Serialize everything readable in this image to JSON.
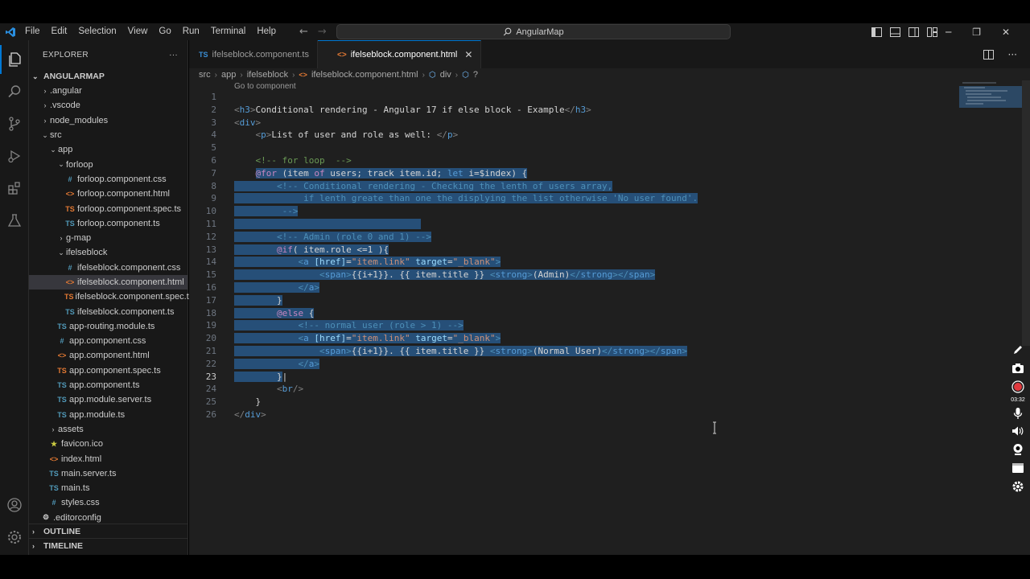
{
  "menu": [
    "File",
    "Edit",
    "Selection",
    "View",
    "Go",
    "Run",
    "Terminal",
    "Help"
  ],
  "search": {
    "label": "AngularMap"
  },
  "explorer": {
    "title": "EXPLORER",
    "more": "···",
    "root": "ANGULARMAP",
    "items": [
      {
        "label": ".angular",
        "indent": 1,
        "kind": "folder",
        "open": false,
        "icon": ""
      },
      {
        "label": ".vscode",
        "indent": 1,
        "kind": "folder",
        "open": false,
        "icon": ""
      },
      {
        "label": "node_modules",
        "indent": 1,
        "kind": "folder",
        "open": false,
        "icon": ""
      },
      {
        "label": "src",
        "indent": 1,
        "kind": "folder",
        "open": true,
        "icon": ""
      },
      {
        "label": "app",
        "indent": 2,
        "kind": "folder",
        "open": true,
        "icon": ""
      },
      {
        "label": "forloop",
        "indent": 3,
        "kind": "folder",
        "open": true,
        "icon": ""
      },
      {
        "label": "forloop.component.css",
        "indent": 4,
        "kind": "css",
        "icon": "#"
      },
      {
        "label": "forloop.component.html",
        "indent": 4,
        "kind": "html",
        "icon": "<>"
      },
      {
        "label": "forloop.component.spec.ts",
        "indent": 4,
        "kind": "spec",
        "icon": "TS"
      },
      {
        "label": "forloop.component.ts",
        "indent": 4,
        "kind": "ts",
        "icon": "TS"
      },
      {
        "label": "g-map",
        "indent": 3,
        "kind": "folder",
        "open": false,
        "icon": ""
      },
      {
        "label": "ifelseblock",
        "indent": 3,
        "kind": "folder",
        "open": true,
        "icon": ""
      },
      {
        "label": "ifelseblock.component.css",
        "indent": 4,
        "kind": "css",
        "icon": "#"
      },
      {
        "label": "ifelseblock.component.html",
        "indent": 4,
        "kind": "html",
        "icon": "<>",
        "selected": true
      },
      {
        "label": "ifelseblock.component.spec.ts",
        "indent": 4,
        "kind": "spec",
        "icon": "TS"
      },
      {
        "label": "ifelseblock.component.ts",
        "indent": 4,
        "kind": "ts",
        "icon": "TS"
      },
      {
        "label": "app-routing.module.ts",
        "indent": 3,
        "kind": "ts",
        "icon": "TS"
      },
      {
        "label": "app.component.css",
        "indent": 3,
        "kind": "css",
        "icon": "#"
      },
      {
        "label": "app.component.html",
        "indent": 3,
        "kind": "html",
        "icon": "<>"
      },
      {
        "label": "app.component.spec.ts",
        "indent": 3,
        "kind": "spec",
        "icon": "TS"
      },
      {
        "label": "app.component.ts",
        "indent": 3,
        "kind": "ts",
        "icon": "TS"
      },
      {
        "label": "app.module.server.ts",
        "indent": 3,
        "kind": "ts",
        "icon": "TS"
      },
      {
        "label": "app.module.ts",
        "indent": 3,
        "kind": "ts",
        "icon": "TS"
      },
      {
        "label": "assets",
        "indent": 2,
        "kind": "folder",
        "open": false,
        "icon": ""
      },
      {
        "label": "favicon.ico",
        "indent": 2,
        "kind": "ico",
        "icon": "★"
      },
      {
        "label": "index.html",
        "indent": 2,
        "kind": "html",
        "icon": "<>"
      },
      {
        "label": "main.server.ts",
        "indent": 2,
        "kind": "ts",
        "icon": "TS"
      },
      {
        "label": "main.ts",
        "indent": 2,
        "kind": "ts",
        "icon": "TS"
      },
      {
        "label": "styles.css",
        "indent": 2,
        "kind": "css",
        "icon": "#"
      },
      {
        "label": ".editorconfig",
        "indent": 1,
        "kind": "config",
        "icon": "⚙"
      }
    ],
    "outline": "OUTLINE",
    "timeline": "TIMELINE"
  },
  "tabs": [
    {
      "badge": "TS",
      "label": "ifelseblock.component.ts",
      "active": false
    },
    {
      "badge": "<>",
      "label": "ifelseblock.component.html",
      "active": true,
      "close": "✕"
    }
  ],
  "breadcrumb": [
    "src",
    "app",
    "ifelseblock",
    "ifelseblock.component.html",
    "div",
    "?"
  ],
  "codelens": "Go to component",
  "code_lines": [
    {
      "n": "1",
      "html": ""
    },
    {
      "n": "2",
      "html": "<span class='p'>&lt;</span><span class='t'>h3</span><span class='p'>&gt;</span><span class='w'>Conditional rendering - Angular 17 if else block - Example</span><span class='p'>&lt;/</span><span class='t'>h3</span><span class='p'>&gt;</span>"
    },
    {
      "n": "3",
      "html": "<span class='p'>&lt;</span><span class='t'>div</span><span class='p'>&gt;</span>"
    },
    {
      "n": "4",
      "html": "    <span class='p'>&lt;</span><span class='t'>p</span><span class='p'>&gt;</span><span class='w'>List of user and role as well: </span><span class='p'>&lt;/</span><span class='t'>p</span><span class='p'>&gt;</span>"
    },
    {
      "n": "5",
      "html": ""
    },
    {
      "n": "6",
      "html": "    <span class='c'>&lt;!-- for loop  --&gt;</span>"
    },
    {
      "n": "7",
      "html": "    <span class='sel'><span class='k'>@for</span><span class='w'> (item </span><span class='k'>of</span><span class='w'> users; track item.id; </span><span class='t'>let</span><span class='w'> i=$index) {</span></span>"
    },
    {
      "n": "8",
      "html": "<span class='sel'>        <span class='c'>&lt;!-- Conditional rendering - Checking the lenth of users array,</span></span>"
    },
    {
      "n": "9",
      "html": "<span class='sel'>             <span class='c'>if lenth greate than one the displying the list otherwise 'No user found'.</span></span>"
    },
    {
      "n": "10",
      "html": "<span class='sel'>         <span class='c'>--&gt;</span></span>"
    },
    {
      "n": "11",
      "html": "<span class='sel'>                                   </span>"
    },
    {
      "n": "12",
      "html": "<span class='sel'>        <span class='c'>&lt;!-- Admin (role 0 and 1) --&gt;</span></span>"
    },
    {
      "n": "13",
      "html": "<span class='sel'>        <span class='k'>@if</span><span class='w'>( item.role &lt;=1 ){</span></span>"
    },
    {
      "n": "14",
      "html": "<span class='sel'>            <span class='p'>&lt;</span><span class='t'>a</span> <span class='a'>[href]</span><span class='w'>=</span><span class='s'>\"item.link\"</span> <span class='a'>target</span><span class='w'>=</span><span class='s'>\"_blank\"</span><span class='p'>&gt;</span></span>"
    },
    {
      "n": "15",
      "html": "<span class='sel'>                <span class='p'>&lt;</span><span class='t'>span</span><span class='p'>&gt;</span><span class='w'>{{i+1}}. {{ item.title }} </span><span class='p'>&lt;</span><span class='t'>strong</span><span class='p'>&gt;</span><span class='w'>(Admin)</span><span class='p'>&lt;/</span><span class='t'>strong</span><span class='p'>&gt;&lt;/</span><span class='t'>span</span><span class='p'>&gt;</span></span>"
    },
    {
      "n": "16",
      "html": "<span class='sel'>            <span class='p'>&lt;/</span><span class='t'>a</span><span class='p'>&gt;</span></span>"
    },
    {
      "n": "17",
      "html": "<span class='sel'>        <span class='w'>}</span></span>"
    },
    {
      "n": "18",
      "html": "<span class='sel'>        <span class='k'>@else</span><span class='w'> {</span></span>"
    },
    {
      "n": "19",
      "html": "<span class='sel'>            <span class='c'>&lt;!-- normal user (role &gt; 1) --&gt;</span></span>"
    },
    {
      "n": "20",
      "html": "<span class='sel'>            <span class='p'>&lt;</span><span class='t'>a</span> <span class='a'>[href]</span><span class='w'>=</span><span class='s'>\"item.link\"</span> <span class='a'>target</span><span class='w'>=</span><span class='s'>\"_blank\"</span><span class='p'>&gt;</span></span>"
    },
    {
      "n": "21",
      "html": "<span class='sel'>                <span class='p'>&lt;</span><span class='t'>span</span><span class='p'>&gt;</span><span class='w'>{{i+1}}. {{ item.title }} </span><span class='p'>&lt;</span><span class='t'>strong</span><span class='p'>&gt;</span><span class='w'>(Normal User)</span><span class='p'>&lt;/</span><span class='t'>strong</span><span class='p'>&gt;&lt;/</span><span class='t'>span</span><span class='p'>&gt;</span></span>"
    },
    {
      "n": "22",
      "html": "<span class='sel'>            <span class='p'>&lt;/</span><span class='t'>a</span><span class='p'>&gt;</span></span>"
    },
    {
      "n": "23",
      "html": "<span class='sel'>        <span class='w'>}</span></span><span class='w'>|</span>",
      "current": true
    },
    {
      "n": "24",
      "html": "        <span class='p'>&lt;</span><span class='t'>br</span><span class='p'>/&gt;</span>"
    },
    {
      "n": "25",
      "html": "    <span class='w'>}</span>"
    },
    {
      "n": "26",
      "html": "<span class='p'>&lt;/</span><span class='t'>div</span><span class='p'>&gt;</span>"
    }
  ],
  "recorder": {
    "time": "03:32"
  },
  "colors": {
    "accent": "#0078d4",
    "selection": "#264f78",
    "record": "#e0393e"
  }
}
